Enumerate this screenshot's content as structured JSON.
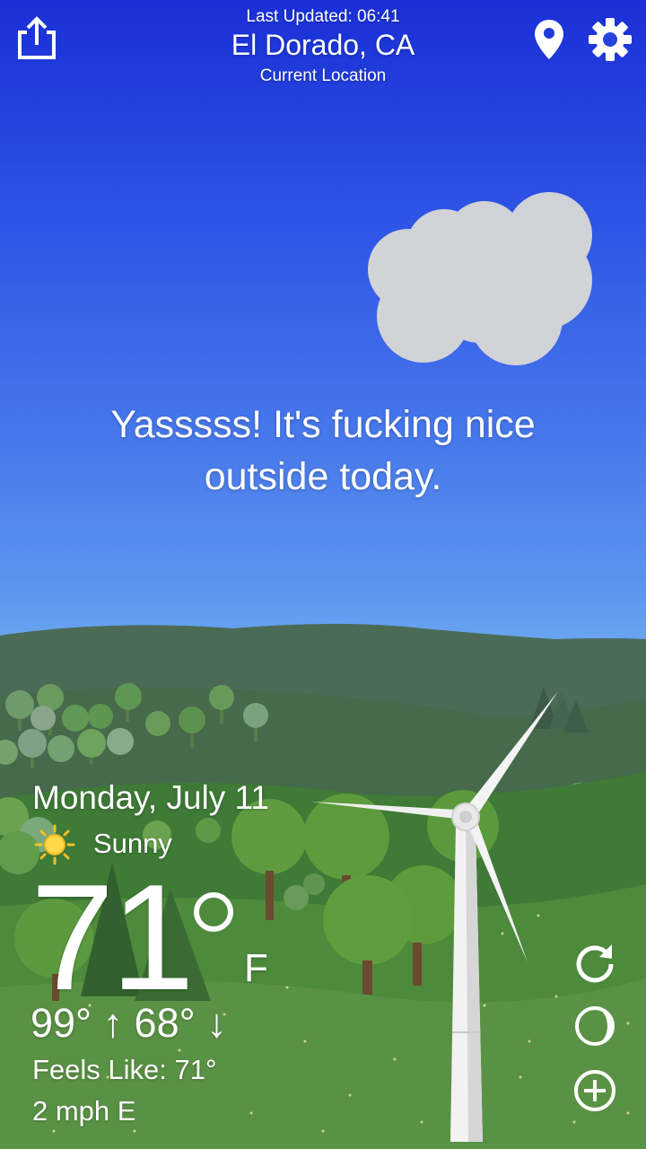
{
  "header": {
    "last_updated": "Last Updated: 06:41",
    "city": "El Dorado, CA",
    "location_label": "Current Location",
    "icons": [
      "share-icon",
      "location-pin-icon",
      "gear-icon"
    ]
  },
  "message": {
    "text": "Yasssss! It's fucking nice outside today."
  },
  "weather": {
    "date": "Monday, July 11",
    "condition": "Sunny",
    "condition_icon": "sun-icon",
    "temperature": "71",
    "unit": "F",
    "hi_lo": "99° ↑  68° ↓",
    "feels_like": "Feels Like: 71°",
    "wind": "2 mph E"
  },
  "controls": {
    "icons": [
      "refresh-icon",
      "moon-phase-icon",
      "add-icon"
    ]
  },
  "colors": {
    "sky_top": "#1a2fd6",
    "sky_bottom": "#6aa6f0",
    "hill_far": "#4a6a56",
    "meadow": "#4f8a3c",
    "text": "#ffffff"
  }
}
